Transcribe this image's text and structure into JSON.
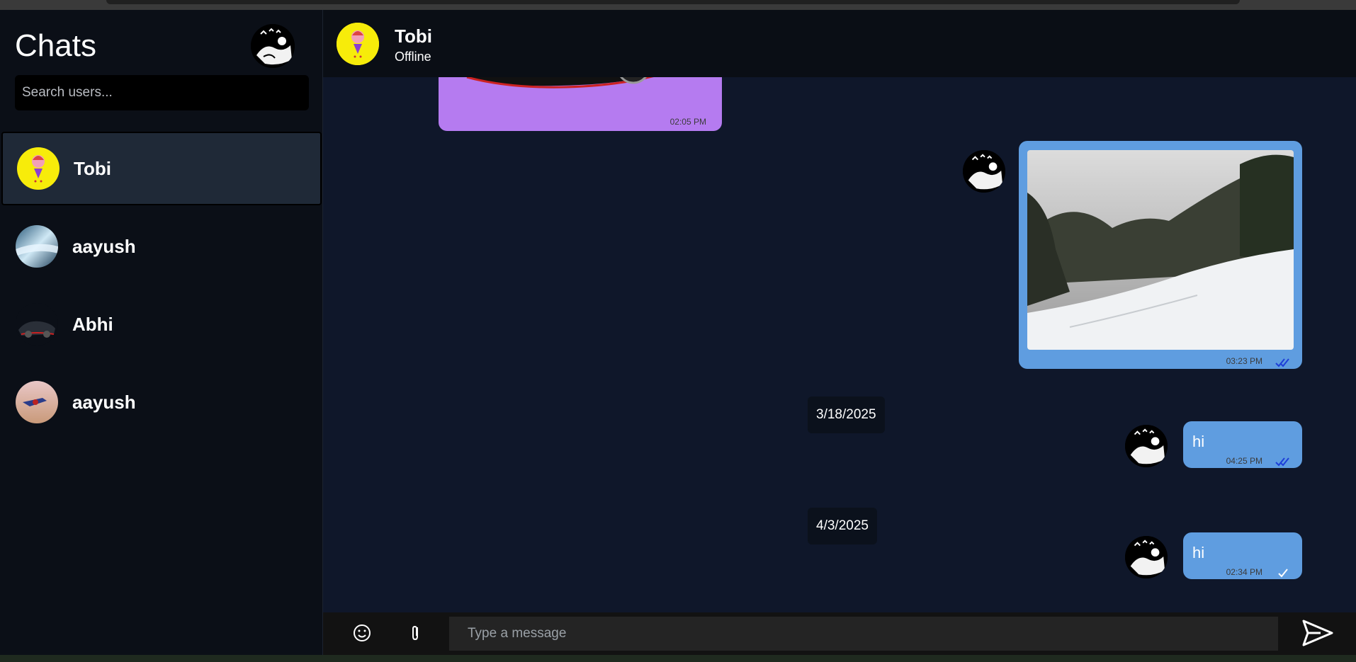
{
  "sidebar": {
    "title": "Chats",
    "search_placeholder": "Search users...",
    "users": [
      {
        "name": "Tobi",
        "active": true
      },
      {
        "name": "aayush",
        "active": false
      },
      {
        "name": "Abhi",
        "active": false
      },
      {
        "name": "aayush",
        "active": false
      }
    ]
  },
  "header": {
    "name": "Tobi",
    "status": "Offline"
  },
  "messages": {
    "purple_time": "02:05 PM",
    "image_time": "03:23 PM",
    "date_1": "3/18/2025",
    "msg_1_text": "hi",
    "msg_1_time": "04:25 PM",
    "date_2": "4/3/2025",
    "msg_2_text": "hi",
    "msg_2_time": "02:34 PM"
  },
  "composer": {
    "placeholder": "Type a message"
  },
  "colors": {
    "sidebar_bg": "#0b0f17",
    "chat_bg": "#0f172a",
    "bubble_blue": "#5f9de0",
    "bubble_purple": "#b57bf0",
    "active_user": "#1f2937",
    "read_tick": "#1d3fd8"
  }
}
